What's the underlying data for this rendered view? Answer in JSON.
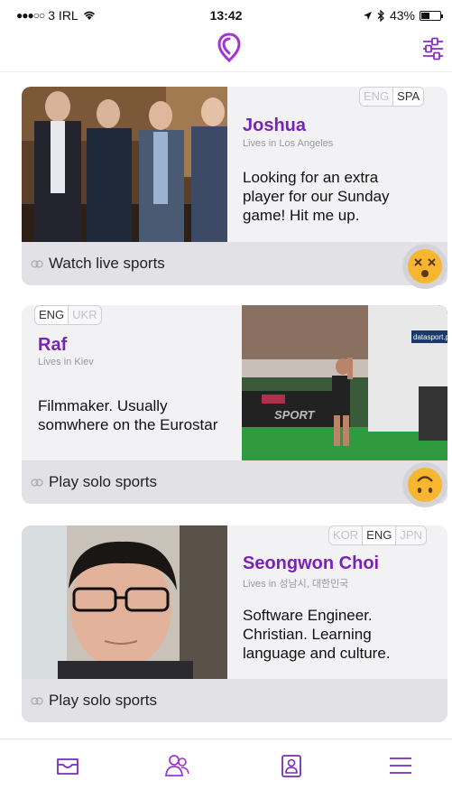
{
  "status_bar": {
    "signal_dots": "●●●○○",
    "carrier": "3 IRL",
    "time": "13:42",
    "battery_percent": "43%",
    "battery_level": 0.43
  },
  "header": {
    "logo_icon": "location-pin-logo-icon",
    "filter_icon": "sliders-icon"
  },
  "cards": [
    {
      "name": "Joshua",
      "lives": "Lives in Los Angeles",
      "bio": "Looking for an extra player for our Sunday game! Hit me up.",
      "languages": [
        {
          "code": "ENG",
          "active": false
        },
        {
          "code": "SPA",
          "active": true
        }
      ],
      "activity": "Watch live sports",
      "emoji": "dizzy-face-emoji",
      "photo": "group-photo"
    },
    {
      "name": "Raf",
      "lives": "Lives in Kiev",
      "bio": "Filmmaker. Usually somwhere on the Eurostar",
      "languages": [
        {
          "code": "ENG",
          "active": true
        },
        {
          "code": "UKR",
          "active": false
        }
      ],
      "activity": "Play solo sports",
      "emoji": "upside-down-face-emoji",
      "photo": "race-finish-photo",
      "photo_text": {
        "banner": "SPORT",
        "sign": "datasport.p"
      }
    },
    {
      "name": "Seongwon Choi",
      "lives": "Lives in 성남시, 대한민국",
      "bio": "Software Engineer. Christian. Learning language and culture.",
      "languages": [
        {
          "code": "KOR",
          "active": false
        },
        {
          "code": "ENG",
          "active": true
        },
        {
          "code": "JPN",
          "active": false
        }
      ],
      "activity": "Play solo sports",
      "photo": "portrait-photo"
    }
  ],
  "tab_bar": {
    "items": [
      "inbox-icon",
      "people-icon",
      "profile-card-icon",
      "menu-icon"
    ]
  },
  "colors": {
    "accent": "#7a22b8",
    "card_bg": "#f2f2f4",
    "footer_bg": "#e2e2e6"
  }
}
